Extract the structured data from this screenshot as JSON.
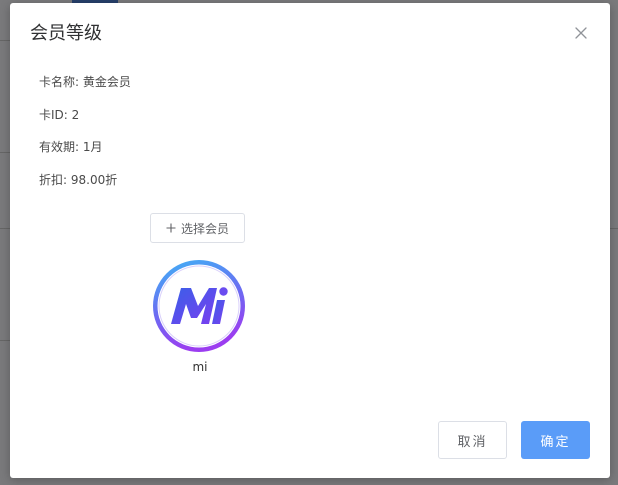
{
  "dialog": {
    "title": "会员等级",
    "close_icon": "close-icon"
  },
  "card_info": {
    "name_line": "卡名称: 黄金会员",
    "id_line": "卡ID: 2",
    "validity_line": "有效期: 1月",
    "discount_line": "折扣: 98.00折"
  },
  "select_member": {
    "label": "选择会员",
    "icon": "plus-icon"
  },
  "members": [
    {
      "name": "mi",
      "avatar_icon": "mi-logo-avatar"
    }
  ],
  "footer": {
    "cancel_label": "取消",
    "confirm_label": "确定"
  },
  "colors": {
    "primary": "#5a9cf8",
    "avatar_ring_start": "#3fb4f5",
    "avatar_ring_end": "#9b3df0"
  }
}
